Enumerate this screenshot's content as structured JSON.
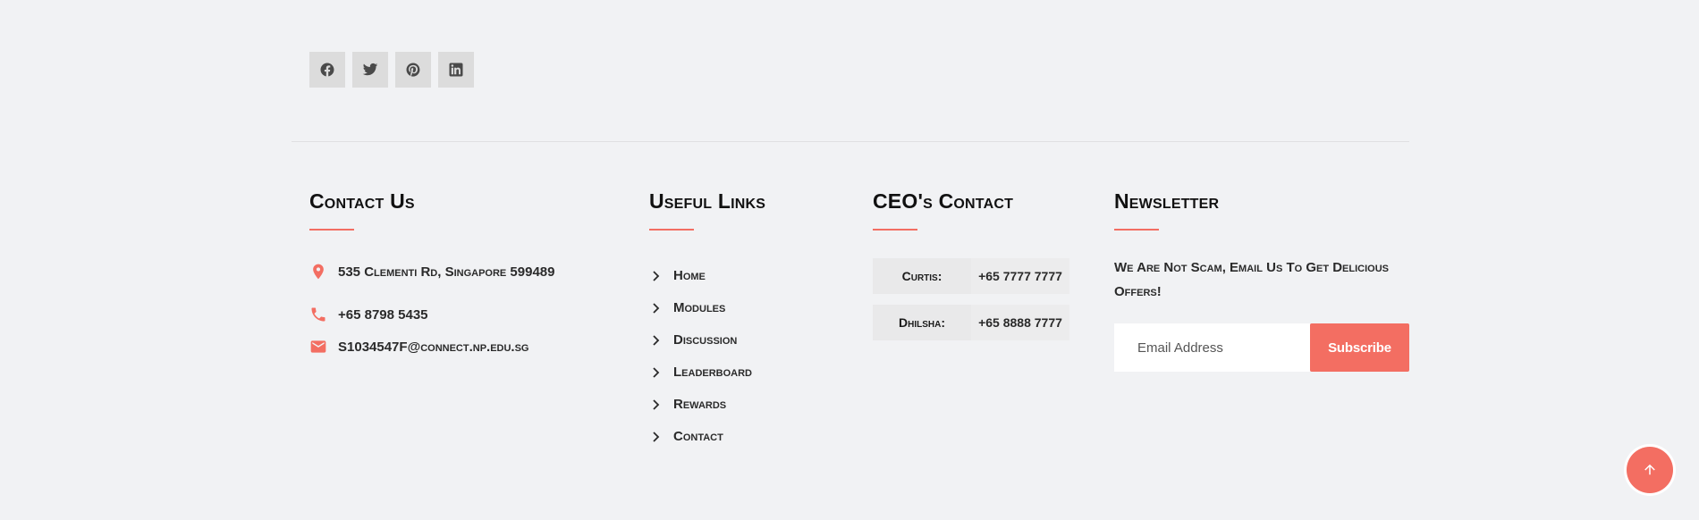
{
  "social": [
    {
      "name": "facebook-icon"
    },
    {
      "name": "twitter-icon"
    },
    {
      "name": "pinterest-icon"
    },
    {
      "name": "linkedin-icon"
    }
  ],
  "contact": {
    "title": "Contact Us",
    "address": "535 Clementi Rd, Singapore 599489",
    "phone": "+65 8798 5435",
    "email": "S1034547F@connect.np.edu.sg"
  },
  "links": {
    "title": "Useful Links",
    "items": [
      "Home",
      "Modules",
      "Discussion",
      "Leaderboard",
      "Rewards",
      "Contact"
    ]
  },
  "ceo": {
    "title": "CEO's Contact",
    "rows": [
      {
        "name": "Curtis:",
        "phone": "+65 7777 7777"
      },
      {
        "name": "Dhilsha:",
        "phone": "+65 8888 7777"
      }
    ]
  },
  "newsletter": {
    "title": "Newsletter",
    "text": "We Are Not Scam, Email Us To Get Delicious Offers!",
    "placeholder": "Email Address",
    "button": "Subscribe"
  },
  "colors": {
    "accent": "#f36e62",
    "background": "#f1f2f4"
  }
}
